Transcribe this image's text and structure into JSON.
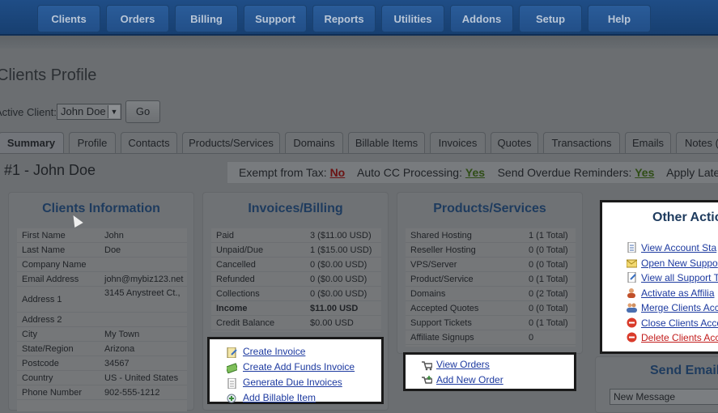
{
  "nav": {
    "items": [
      "Clients",
      "Orders",
      "Billing",
      "Support",
      "Reports",
      "Utilities",
      "Addons",
      "Setup",
      "Help"
    ]
  },
  "page": {
    "title": "Clients Profile",
    "active_client_label": "Active Client:",
    "active_client_value": "John Doe",
    "go_label": "Go"
  },
  "tabs": [
    "Summary",
    "Profile",
    "Contacts",
    "Products/Services",
    "Domains",
    "Billable Items",
    "Invoices",
    "Quotes",
    "Transactions",
    "Emails",
    "Notes ("
  ],
  "client_header": {
    "number": "#1 - John Doe",
    "exempt_label": "Exempt from Tax:",
    "exempt_value": "No",
    "autocc_label": "Auto CC Processing:",
    "autocc_value": "Yes",
    "overdue_label": "Send Overdue Reminders:",
    "overdue_value": "Yes",
    "late_label": "Apply Late"
  },
  "clients_info": {
    "title": "Clients Information",
    "rows": [
      {
        "k": "First Name",
        "v": "John"
      },
      {
        "k": "Last Name",
        "v": "Doe"
      },
      {
        "k": "Company Name",
        "v": ""
      },
      {
        "k": "Email Address",
        "v": "john@mybiz123.net"
      },
      {
        "k": "Address 1",
        "v": "3145 Anystreet Ct.,"
      },
      {
        "k": "Address 2",
        "v": ""
      },
      {
        "k": "City",
        "v": "My Town"
      },
      {
        "k": "State/Region",
        "v": "Arizona"
      },
      {
        "k": "Postcode",
        "v": "34567"
      },
      {
        "k": "Country",
        "v": "US - United States"
      },
      {
        "k": "Phone Number",
        "v": "902-555-1212"
      }
    ]
  },
  "invoices": {
    "title": "Invoices/Billing",
    "rows": [
      {
        "k": "Paid",
        "v": "3 ($11.00 USD)"
      },
      {
        "k": "Unpaid/Due",
        "v": "1 ($15.00 USD)"
      },
      {
        "k": "Cancelled",
        "v": "0 ($0.00 USD)"
      },
      {
        "k": "Refunded",
        "v": "0 ($0.00 USD)"
      },
      {
        "k": "Collections",
        "v": "0 ($0.00 USD)"
      },
      {
        "k": "Income",
        "v": "$11.00 USD"
      },
      {
        "k": "Credit Balance",
        "v": "$0.00 USD"
      }
    ],
    "links": [
      "Create Invoice",
      "Create Add Funds Invoice",
      "Generate Due Invoices",
      "Add Billable Item"
    ]
  },
  "products": {
    "title": "Products/Services",
    "rows": [
      {
        "k": "Shared Hosting",
        "v": "1 (1 Total)"
      },
      {
        "k": "Reseller Hosting",
        "v": "0 (0 Total)"
      },
      {
        "k": "VPS/Server",
        "v": "0 (0 Total)"
      },
      {
        "k": "Product/Service",
        "v": "0 (1 Total)"
      },
      {
        "k": "Domains",
        "v": "0 (2 Total)"
      },
      {
        "k": "Accepted Quotes",
        "v": "0 (0 Total)"
      },
      {
        "k": "Support Tickets",
        "v": "0 (1 Total)"
      },
      {
        "k": "Affiliate Signups",
        "v": "0"
      }
    ],
    "links": [
      "View Orders",
      "Add New Order"
    ]
  },
  "other_actions": {
    "title": "Other Actio",
    "links": [
      "View Account Sta",
      "Open New Suppo",
      "View all Support T",
      "Activate as Affilia",
      "Merge Clients Acc",
      "Close Clients Acco",
      "Delete Clients Acc"
    ]
  },
  "send_email": {
    "title": "Send Email",
    "select_value": "New Message"
  },
  "colors": {
    "link": "#1d3aa0",
    "danger": "#c21b1b",
    "yes": "#2f4d16",
    "no": "#6b1414",
    "panel_title": "#1e3b5e"
  }
}
